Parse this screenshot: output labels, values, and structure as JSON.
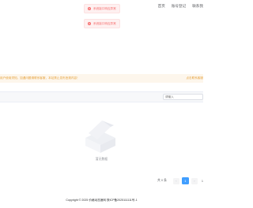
{
  "nav": {
    "items": [
      "首页",
      "账号登记",
      "联系我"
    ]
  },
  "toasts": [
    {
      "text": "系统接口响应异常"
    },
    {
      "text": "系统接口响应异常"
    }
  ],
  "banner": {
    "left": "用户使用须知，如遇问题请联系客服，本站禁止发布违规内容！",
    "right": "点击联系客服"
  },
  "search": {
    "placeholder": "请输入"
  },
  "empty": {
    "text": "暂无数据"
  },
  "pagination": {
    "total": "共 0 条",
    "prev": "‹",
    "current": "1",
    "next": "›",
    "jump": "1"
  },
  "footer": {
    "text": "Copyright © 2025 价格动态速网  陕ICP备2025111111号-1"
  },
  "colors": {
    "error": "#f56c6c",
    "warning": "#e6a23c",
    "primary": "#409eff"
  }
}
